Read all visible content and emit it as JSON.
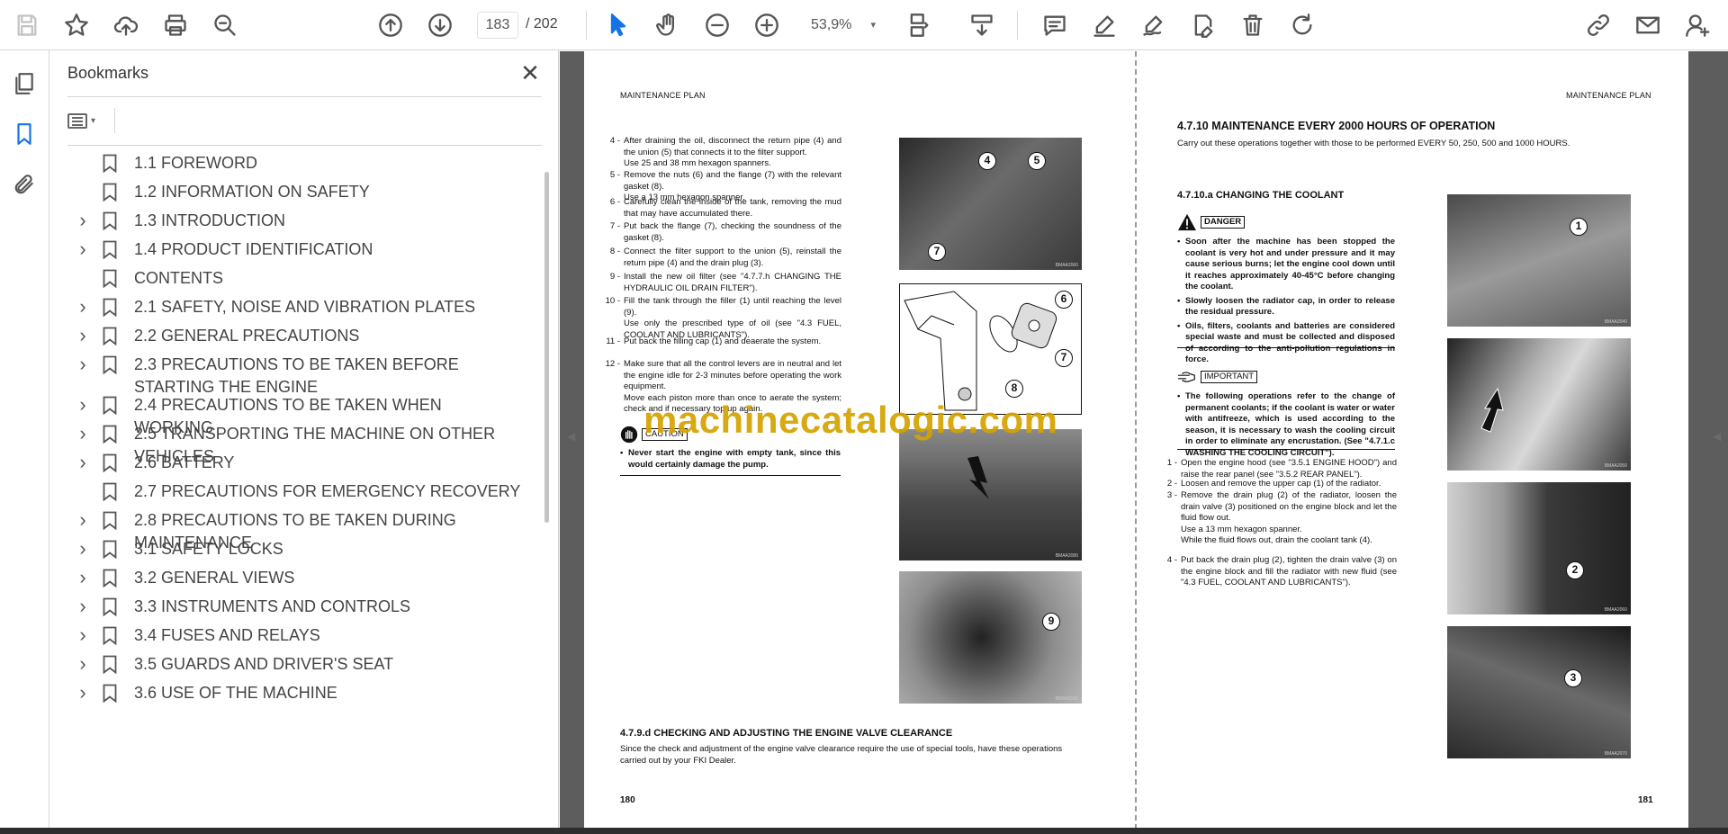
{
  "toolbar": {
    "page_current": "183",
    "page_total": "/  202",
    "zoom": "53,9%",
    "zoom_caret": "▾"
  },
  "panel": {
    "title": "Bookmarks",
    "close": "✕",
    "options_caret": "▾"
  },
  "bookmarks": [
    {
      "label": "1.1 FOREWORD",
      "expandable": false
    },
    {
      "label": "1.2 INFORMATION ON SAFETY",
      "expandable": false
    },
    {
      "label": "1.3 INTRODUCTION",
      "expandable": true
    },
    {
      "label": "1.4 PRODUCT IDENTIFICATION",
      "expandable": true
    },
    {
      "label": "CONTENTS",
      "expandable": false
    },
    {
      "label": "2.1 SAFETY, NOISE AND VIBRATION PLATES",
      "expandable": true
    },
    {
      "label": "2.2 GENERAL PRECAUTIONS",
      "expandable": true
    },
    {
      "label": "2.3 PRECAUTIONS TO BE TAKEN BEFORE STARTING THE ENGINE",
      "expandable": true
    },
    {
      "label": "2.4 PRECAUTIONS TO BE TAKEN WHEN WORKING",
      "expandable": true
    },
    {
      "label": "2.5 TRANSPORTING THE MACHINE ON OTHER VEHICLES",
      "expandable": true
    },
    {
      "label": "2.6 BATTERY",
      "expandable": true
    },
    {
      "label": "2.7 PRECAUTIONS FOR EMERGENCY RECOVERY",
      "expandable": false
    },
    {
      "label": "2.8 PRECAUTIONS TO BE TAKEN DURING MAINTENANCE",
      "expandable": true
    },
    {
      "label": "3.1 SAFETY LOCKS",
      "expandable": true
    },
    {
      "label": "3.2 GENERAL VIEWS",
      "expandable": true
    },
    {
      "label": "3.3 INSTRUMENTS AND CONTROLS",
      "expandable": true
    },
    {
      "label": "3.4 FUSES AND RELAYS",
      "expandable": true
    },
    {
      "label": "3.5 GUARDS AND DRIVER'S SEAT",
      "expandable": true
    },
    {
      "label": "3.6 USE OF THE MACHINE",
      "expandable": true
    }
  ],
  "left_page": {
    "header": "MAINTENANCE PLAN",
    "page_number": "180",
    "steps": [
      {
        "n": "4 -",
        "lines": [
          "After draining the oil, disconnect the return pipe (4) and the union (5) that connects it to the filter support.",
          "Use 25 and 38 mm hexagon spanners."
        ]
      },
      {
        "n": "5 -",
        "lines": [
          "Remove the nuts (6) and the flange (7) with the relevant gasket (8).",
          "Use a 13 mm hexagon spanner."
        ]
      },
      {
        "n": "6 -",
        "lines": [
          "Carefully clean the inside of the tank, removing the mud that may have accumulated there."
        ]
      },
      {
        "n": "7 -",
        "lines": [
          "Put back the flange (7), checking the soundness of the gasket (8)."
        ]
      },
      {
        "n": "8 -",
        "lines": [
          "Connect the filter support to the union (5), reinstall the return pipe (4) and the drain plug (3)."
        ]
      },
      {
        "n": "9 -",
        "lines": [
          "Install the new oil filter (see \"4.7.7.h CHANGING THE HYDRAULIC OIL DRAIN FILTER\")."
        ]
      },
      {
        "n": "10 -",
        "lines": [
          "Fill the tank through the filler (1) until reaching the level (9).",
          "Use only the prescribed type of oil (see \"4.3 FUEL, COOLANT AND LUBRICANTS\")."
        ]
      },
      {
        "n": "11 -",
        "lines": [
          "Put back the filling cap (1) and deaerate the system."
        ]
      },
      {
        "n": "12 -",
        "lines": [
          "Make sure that all the control levers are in neutral and let the engine idle for 2-3 minutes before operating the work equipment.",
          "Move each piston more than once to aerate the system; check and if necessary top up again."
        ]
      }
    ],
    "caution_label": "CAUTION",
    "caution_text": "Never start the engine with empty tank, since this would certainly damage the pump.",
    "section_heading": "4.7.9.d    CHECKING AND ADJUSTING THE ENGINE VALVE CLEARANCE",
    "section_text": "Since the check and adjustment of the engine valve clearance require the use of special tools, have these operations carried out by your FKI Dealer.",
    "callouts": {
      "p1": [
        "4",
        "5",
        "7"
      ],
      "p2": [
        "6",
        "7",
        "8"
      ],
      "p4": [
        "9"
      ]
    }
  },
  "right_page": {
    "header": "MAINTENANCE PLAN",
    "page_number": "181",
    "title": "4.7.10 MAINTENANCE EVERY 2000 HOURS OF OPERATION",
    "intro": "Carry out these operations together with those to be performed EVERY 50, 250, 500 and 1000 HOURS.",
    "sub_heading": "4.7.10.a  CHANGING THE COOLANT",
    "danger_label": "DANGER",
    "danger_bullets": [
      "Soon after the machine has been stopped the coolant is very hot and under pressure and it may cause serious burns; let the engine cool down until it reaches approximately 40-45°C before changing the coolant.",
      "Slowly loosen the radiator cap, in order to release the residual pressure.",
      "Oils, filters, coolants and batteries are considered special waste and must be collected and disposed of according to the anti-pollution regulations in force."
    ],
    "important_label": "IMPORTANT",
    "important_bullets": [
      "The following operations refer to the change of permanent coolants; if the coolant is water or water with antifreeze, which is used according to the season, it is necessary to wash the cooling circuit in order to eliminate any encrustation. (See \"4.7.1.c WASHING THE COOLING CIRCUIT\")."
    ],
    "steps": [
      {
        "n": "1 -",
        "lines": [
          "Open the engine hood (see \"3.5.1 ENGINE HOOD\") and raise the rear panel (see \"3.5.2 REAR PANEL\")."
        ]
      },
      {
        "n": "2 -",
        "lines": [
          "Loosen and remove the upper cap (1) of the radiator."
        ]
      },
      {
        "n": "3 -",
        "lines": [
          "Remove the drain plug (2) of the radiator, loosen the drain valve (3) positioned on the engine block and let the fluid flow out.",
          "Use a 13 mm hexagon spanner.",
          "While the fluid flows out, drain the coolant tank (4)."
        ]
      },
      {
        "n": "4 -",
        "lines": [
          "Put back the drain plug (2), tighten the drain valve (3) on the engine block and fill the radiator with new fluid (see \"4.3 FUEL, COOLANT AND LUBRICANTS\")."
        ]
      }
    ],
    "callouts": {
      "p1": [
        "1"
      ],
      "p3": [
        "2"
      ],
      "p4": [
        "3"
      ]
    }
  },
  "watermark": "machinecatalogic.com",
  "photo_captions": [
    "BMAA2060",
    "BMAA2070",
    "BMAA2080",
    "BMAA2090",
    "BMAA2040",
    "BMAA2050",
    "BMAA2060",
    "BMAA2070"
  ],
  "icons": {
    "save": "save-icon",
    "star": "star-icon",
    "upload": "upload-icon",
    "print": "print-icon",
    "zoom": "zoom-search-icon",
    "prev": "arrow-up-circle-icon",
    "next": "arrow-down-circle-icon"
  }
}
